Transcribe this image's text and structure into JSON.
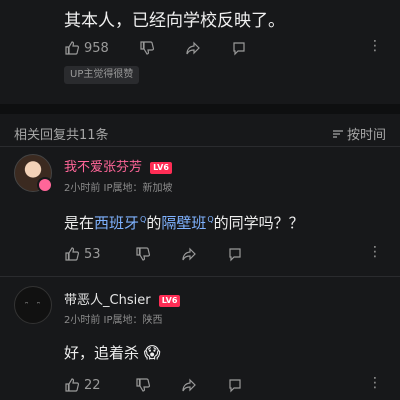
{
  "top_comment": {
    "text": "其本人，已经向学校反映了。",
    "likes": "958",
    "up_tag": "UP主觉得很赞"
  },
  "replies_header": {
    "title": "相关回复共11条",
    "sort_label": "按时间"
  },
  "replies": [
    {
      "username": "我不爱张芬芳",
      "level": "LV6",
      "meta": "2小时前 IP属地：新加坡",
      "text_prefix": "是在",
      "link1": "西班牙",
      "text_middle": "的",
      "link2": "隔壁班",
      "text_suffix": "的同学吗？？",
      "likes": "53",
      "username_color": "#ff6699"
    },
    {
      "username": "带恶人_Chsier",
      "level": "LV6",
      "meta": "2小时前 IP属地：陕西",
      "text": "好，追着杀",
      "emoji": "😱",
      "likes": "22"
    }
  ],
  "icons": [
    "thumbs-up-icon",
    "thumbs-down-icon",
    "share-icon",
    "comment-icon",
    "more-icon",
    "sort-icon",
    "search-icon",
    "avatar"
  ]
}
